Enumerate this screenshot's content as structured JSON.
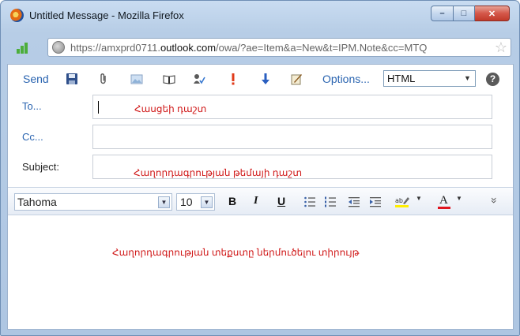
{
  "window": {
    "title": "Untitled Message - Mozilla Firefox",
    "minimize": "–",
    "maximize": "□",
    "close": "✕"
  },
  "address": {
    "url_prefix": "https://amxprd0711.",
    "url_domain": "outlook.com",
    "url_suffix": "/owa/?ae=Item&a=New&t=IPM.Note&cc=MTQ"
  },
  "toolbar": {
    "send_label": "Send",
    "options_label": "Options...",
    "format_value": "HTML",
    "help_label": "?",
    "icons": [
      "save-icon",
      "attach-icon",
      "image-icon",
      "address-book-icon",
      "check-names-icon",
      "importance-high-icon",
      "importance-low-icon",
      "signature-icon"
    ]
  },
  "fields": {
    "to_label": "To...",
    "to_hint": "Հասցեի դաշտ",
    "cc_label": "Cc...",
    "subject_label": "Subject:",
    "subject_hint": "Հաղորդագրության թեմայի դաշտ"
  },
  "format": {
    "font_value": "Tahoma",
    "size_value": "10",
    "bold": "B",
    "italic": "I",
    "underline": "U",
    "font_color_letter": "A",
    "more": "»"
  },
  "body": {
    "hint": "Հաղորդագրության տեքստը ներմուծելու տիրույթ"
  },
  "colors": {
    "link_blue": "#2a64b0",
    "hint_red": "#d01818"
  }
}
